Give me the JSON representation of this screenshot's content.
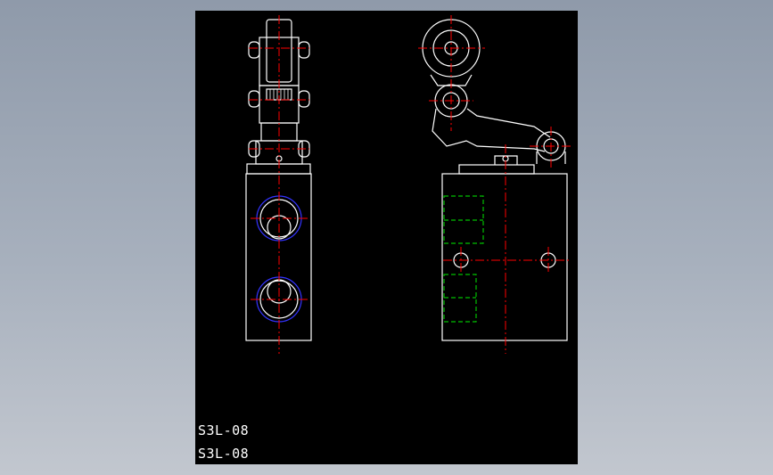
{
  "drawing": {
    "part_labels": [
      "S3L-08",
      "S3L-08"
    ]
  },
  "colors": {
    "background": "#a7b0bd",
    "viewport": "#000000",
    "outline": "#ffffff",
    "centerline": "#ff0000",
    "hidden_line": "#00c000",
    "port_circle": "#3333ff"
  }
}
